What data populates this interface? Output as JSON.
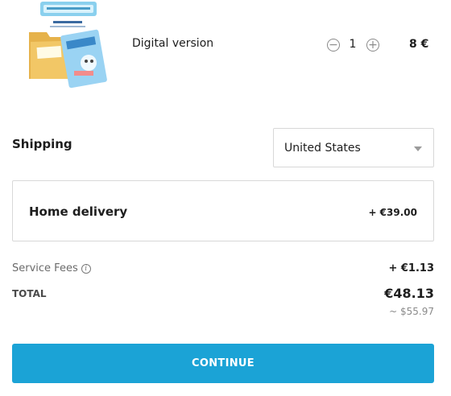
{
  "product": {
    "name": "Digital version",
    "quantity": "1",
    "price": "8 €",
    "image_icon": "game-box-product-icon"
  },
  "shipping": {
    "label": "Shipping",
    "country": "United States"
  },
  "delivery": {
    "label": "Home delivery",
    "price": "+ €39.00"
  },
  "fees": {
    "label": "Service Fees",
    "value": "+ €1.13"
  },
  "total": {
    "label": "TOTAL",
    "value": "€48.13",
    "approx": "~ $55.97"
  },
  "cta": {
    "label": "CONTINUE",
    "color": "#1ba3d6"
  }
}
